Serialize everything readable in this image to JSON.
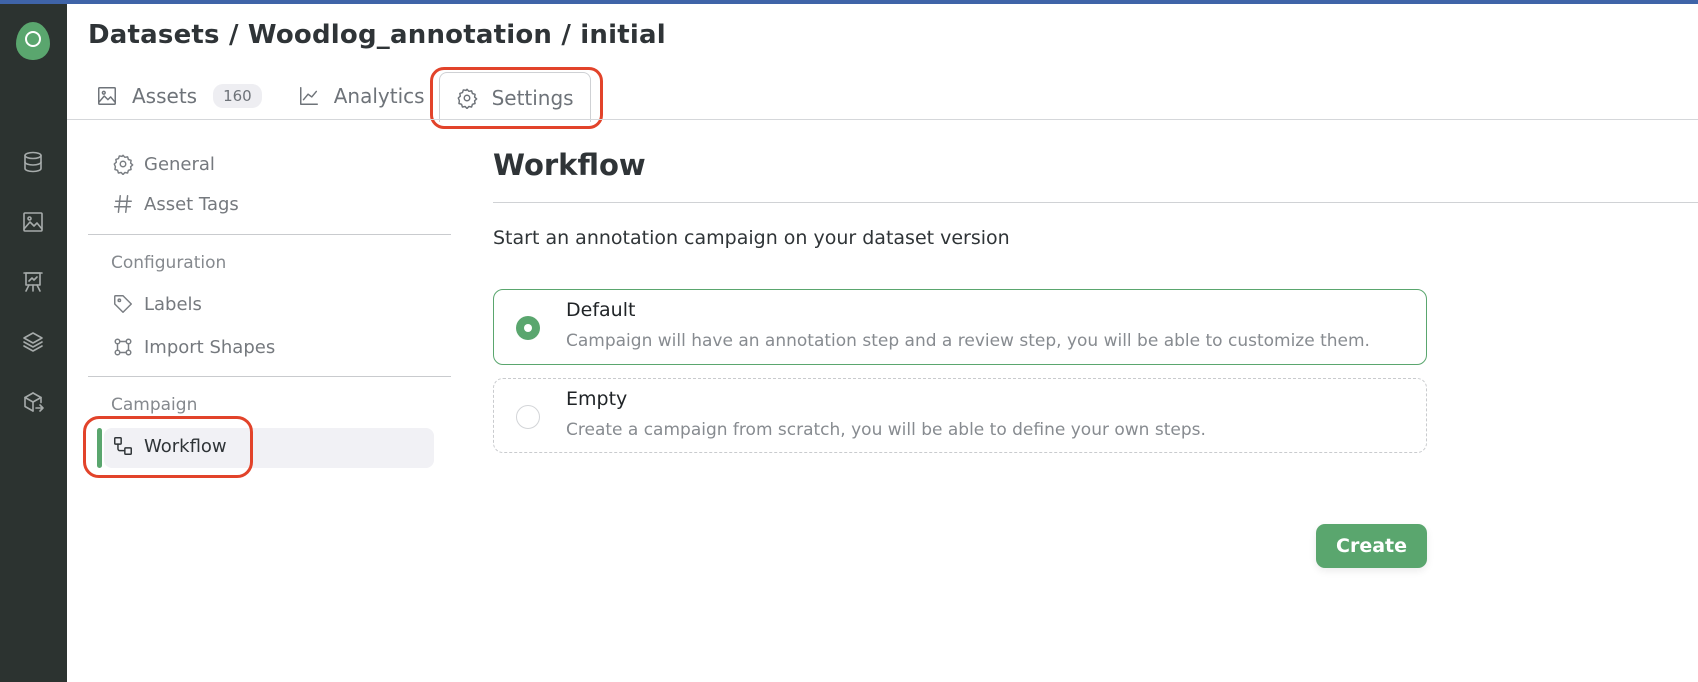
{
  "breadcrumb": {
    "text": "Datasets / Woodlog_annotation / initial",
    "parts": [
      "Datasets",
      "Woodlog_annotation",
      "initial"
    ]
  },
  "rail": {
    "icons": [
      "datasets-icon",
      "images-icon",
      "experiments-icon",
      "layers-icon",
      "deployments-icon"
    ]
  },
  "tabs": [
    {
      "label": "Assets",
      "icon": "image-icon",
      "badge": "160"
    },
    {
      "label": "Analytics",
      "icon": "chart-line-icon"
    },
    {
      "label": "Settings",
      "icon": "gear-icon",
      "active": true
    }
  ],
  "sidebar": {
    "items_top": [
      {
        "label": "General",
        "icon": "gear-icon"
      },
      {
        "label": "Asset Tags",
        "icon": "hash-icon"
      }
    ],
    "configuration": {
      "group": "Configuration",
      "items": [
        {
          "label": "Labels",
          "icon": "tag-icon"
        },
        {
          "label": "Import Shapes",
          "icon": "shapes-icon"
        }
      ]
    },
    "campaign": {
      "group": "Campaign",
      "items": [
        {
          "label": "Workflow",
          "icon": "workflow-icon",
          "active": true
        }
      ]
    }
  },
  "main": {
    "title": "Workflow",
    "subtitle": "Start an annotation campaign on your dataset version",
    "options": [
      {
        "title": "Default",
        "description": "Campaign will have an annotation step and a review step, you will be able to customize them.",
        "selected": true
      },
      {
        "title": "Empty",
        "description": "Create a campaign from scratch, you will be able to define your own steps.",
        "selected": false
      }
    ],
    "create_label": "Create"
  },
  "colors": {
    "accent": "#5aa66e",
    "rail": "#2c3330",
    "highlight": "#e2432a"
  }
}
